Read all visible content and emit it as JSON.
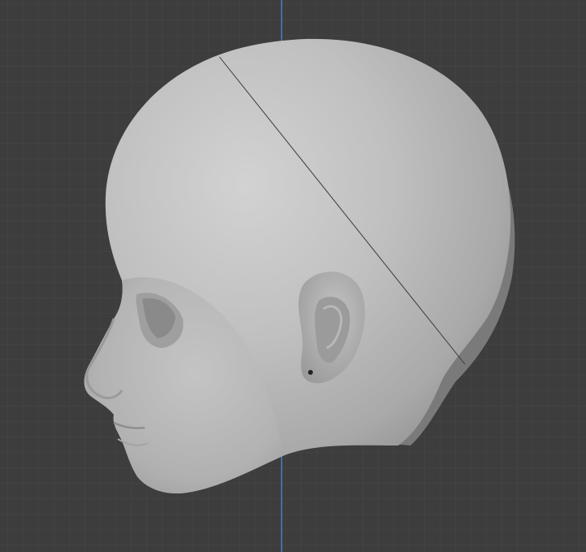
{
  "viewport": {
    "mode": "3d-viewport",
    "background": "#3d3d3d",
    "grid": {
      "minor_color": "#474747",
      "major_color": "#545454",
      "visible": true
    },
    "z_axis_color": "#4a7fc7",
    "object": {
      "type": "sculpted-head",
      "view": "left-side",
      "base_color": "#b8b8b8",
      "seam_color": "#3a3a3a"
    }
  }
}
